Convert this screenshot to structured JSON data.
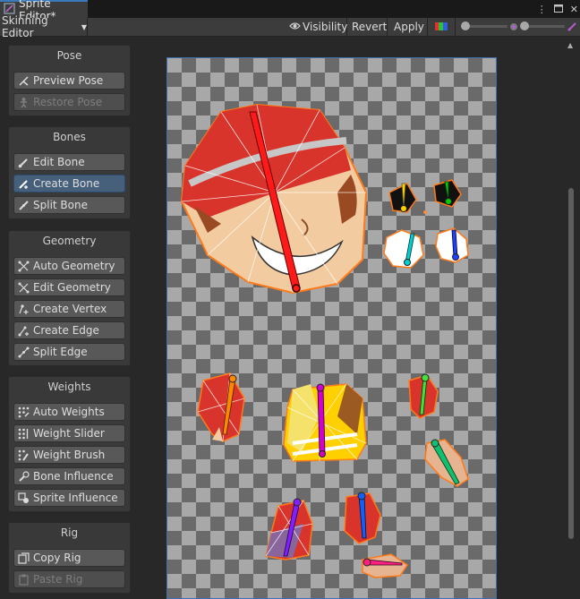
{
  "window": {
    "tab_title": "Sprite Editor*"
  },
  "toolbar": {
    "mode_dropdown": "Skinning Editor",
    "visibility_label": "Visibility",
    "revert_label": "Revert",
    "apply_label": "Apply",
    "slider_left_value": 0,
    "slider_right_value": 0
  },
  "panels": {
    "pose": {
      "title": "Pose",
      "buttons": [
        "Preview Pose",
        "Restore Pose"
      ]
    },
    "bones": {
      "title": "Bones",
      "buttons": [
        "Edit Bone",
        "Create Bone",
        "Split Bone"
      ]
    },
    "geometry": {
      "title": "Geometry",
      "buttons": [
        "Auto Geometry",
        "Edit Geometry",
        "Create Vertex",
        "Create Edge",
        "Split Edge"
      ]
    },
    "weights": {
      "title": "Weights",
      "buttons": [
        "Auto Weights",
        "Weight Slider",
        "Weight Brush",
        "Bone Influence",
        "Sprite Influence"
      ]
    },
    "rig": {
      "title": "Rig",
      "buttons": [
        "Copy Rig",
        "Paste Rig"
      ]
    }
  },
  "state": {
    "active_tool": "Create Bone",
    "disabled": [
      "Restore Pose",
      "Paste Rig"
    ]
  },
  "colors": {
    "accent": "#3a79bb",
    "outline": "#ff7a1a",
    "bones": [
      "#ff1a1a",
      "#ffd000",
      "#00d000",
      "#00d0d0",
      "#2040ff",
      "#ff8800",
      "#d000d0",
      "#40e040",
      "#10c070",
      "#8020ff",
      "#1060ff",
      "#ff2080"
    ]
  }
}
